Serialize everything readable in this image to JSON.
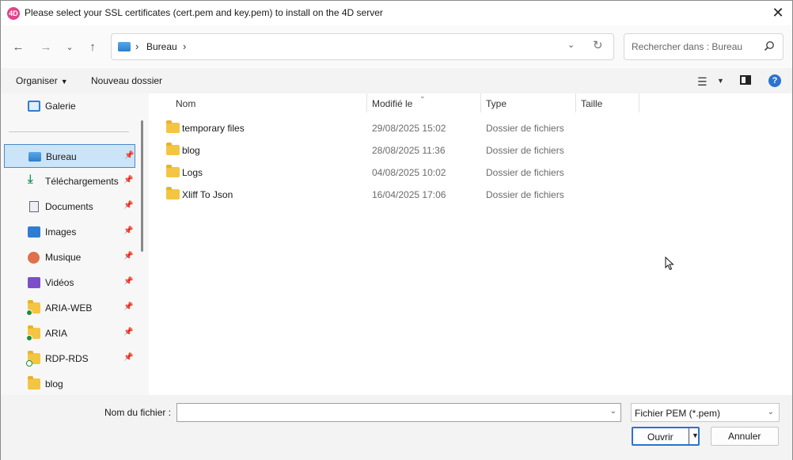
{
  "window": {
    "title": "Please select your SSL certificates (cert.pem and key.pem) to install on the 4D server",
    "app_icon_label": "4D"
  },
  "nav": {
    "address": {
      "location": "Bureau"
    },
    "search": {
      "placeholder": "Rechercher dans : Bureau"
    }
  },
  "toolbar": {
    "organize_label": "Organiser",
    "new_folder_label": "Nouveau dossier"
  },
  "sidebar": {
    "top_item": {
      "label": "Galerie",
      "icon": "gallery-icon"
    },
    "items": [
      {
        "label": "Bureau",
        "icon": "desktop-icon",
        "pinned": true,
        "selected": true
      },
      {
        "label": "Téléchargements",
        "icon": "download-icon",
        "pinned": true
      },
      {
        "label": "Documents",
        "icon": "document-icon",
        "pinned": true
      },
      {
        "label": "Images",
        "icon": "images-icon",
        "pinned": true
      },
      {
        "label": "Musique",
        "icon": "music-icon",
        "pinned": true
      },
      {
        "label": "Vidéos",
        "icon": "video-icon",
        "pinned": true
      },
      {
        "label": "ARIA-WEB",
        "icon": "folder-synced-icon",
        "pinned": true
      },
      {
        "label": "ARIA",
        "icon": "folder-synced-icon",
        "pinned": true
      },
      {
        "label": "RDP-RDS",
        "icon": "folder-available-icon",
        "pinned": true
      },
      {
        "label": "blog",
        "icon": "folder-icon",
        "pinned": false
      }
    ]
  },
  "filelist": {
    "columns": [
      "Nom",
      "Modifié le",
      "Type",
      "Taille"
    ],
    "rows": [
      {
        "name": "temporary files",
        "modified": "29/08/2025 15:02",
        "type": "Dossier de fichiers",
        "size": ""
      },
      {
        "name": "blog",
        "modified": "28/08/2025 11:36",
        "type": "Dossier de fichiers",
        "size": ""
      },
      {
        "name": "Logs",
        "modified": "04/08/2025 10:02",
        "type": "Dossier de fichiers",
        "size": ""
      },
      {
        "name": "Xliff To Json",
        "modified": "16/04/2025 17:06",
        "type": "Dossier de fichiers",
        "size": ""
      }
    ]
  },
  "footer": {
    "filename_label": "Nom du fichier :",
    "filename_value": "",
    "filter_value": "Fichier PEM (*.pem)",
    "open_label": "Ouvrir",
    "cancel_label": "Annuler"
  },
  "colors": {
    "accent": "#2a73d0",
    "selection": "#cce4f7",
    "folder": "#f4c542"
  }
}
